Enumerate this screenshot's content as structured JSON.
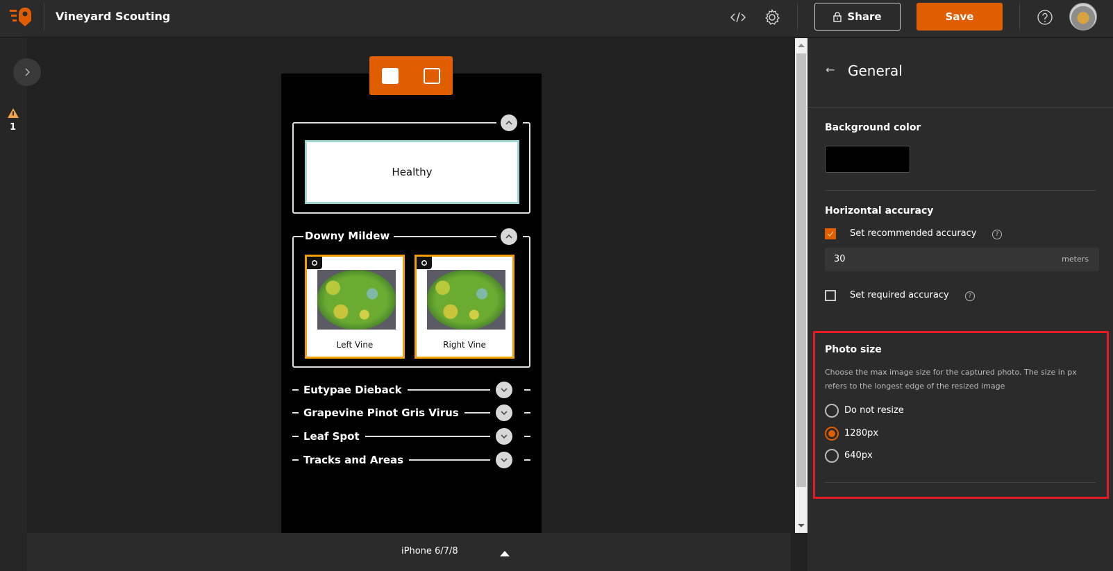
{
  "app": {
    "title": "Vineyard Scouting",
    "brand_color": "#e05e00"
  },
  "toolbar": {
    "code_icon": "code-icon",
    "settings_icon": "gear-icon",
    "share_label": "Share",
    "save_label": "Save",
    "help_icon": "help-icon"
  },
  "left_rail": {
    "expand_icon": "chevron-right-icon",
    "warning_count": "1"
  },
  "preview": {
    "groups": [
      {
        "label": "",
        "expanded": true,
        "items": [
          {
            "type": "choice",
            "label": "Healthy"
          }
        ]
      },
      {
        "label": "Downy Mildew",
        "expanded": true,
        "items": [
          {
            "type": "photo",
            "label": "Left Vine"
          },
          {
            "type": "photo",
            "label": "Right Vine"
          }
        ]
      },
      {
        "label": "Eutypae Dieback",
        "expanded": false
      },
      {
        "label": "Grapevine Pinot Gris Virus",
        "expanded": false
      },
      {
        "label": "Leaf Spot",
        "expanded": false
      },
      {
        "label": "Tracks and Areas",
        "expanded": false
      }
    ],
    "device": "iPhone 6/7/8"
  },
  "panel": {
    "title": "General",
    "background_color": {
      "label": "Background color",
      "value": "#000000"
    },
    "horizontal_accuracy": {
      "label": "Horizontal accuracy",
      "recommended": {
        "label": "Set recommended accuracy",
        "checked": true,
        "value": "30",
        "unit": "meters"
      },
      "required": {
        "label": "Set required accuracy",
        "checked": false
      }
    },
    "photo_size": {
      "label": "Photo size",
      "description": "Choose the max image size for the captured photo. The size in px refers to the longest edge of the resized image",
      "options": [
        {
          "label": "Do not resize",
          "selected": false
        },
        {
          "label": "1280px",
          "selected": true
        },
        {
          "label": "640px",
          "selected": false
        }
      ]
    }
  }
}
